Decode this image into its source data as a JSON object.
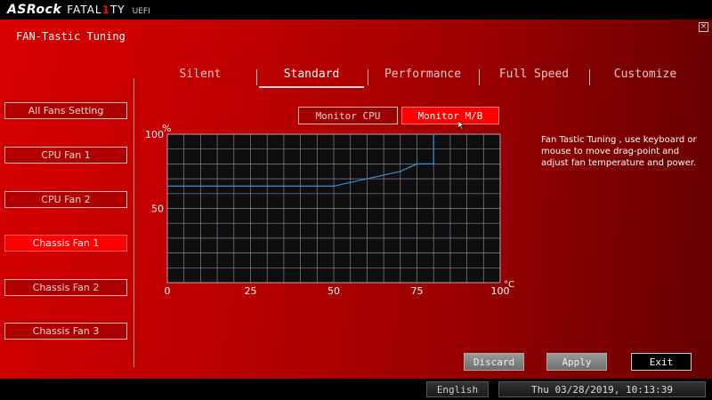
{
  "header": {
    "brand": "ASRock",
    "product_pre": "FATAL",
    "product_one": "1",
    "product_post": "TY",
    "edition": "UEFI",
    "close_glyph": "×"
  },
  "page_title": "FAN-Tastic Tuning",
  "sidebar": {
    "items": [
      {
        "label": "All Fans Setting",
        "active": false
      },
      {
        "label": "CPU Fan 1",
        "active": false
      },
      {
        "label": "CPU Fan 2",
        "active": false
      },
      {
        "label": "Chassis Fan 1",
        "active": true
      },
      {
        "label": "Chassis Fan 2",
        "active": false
      },
      {
        "label": "Chassis Fan 3",
        "active": false
      }
    ]
  },
  "tabs": [
    {
      "label": "Silent",
      "active": false
    },
    {
      "label": "Standard",
      "active": true
    },
    {
      "label": "Performance",
      "active": false
    },
    {
      "label": "Full Speed",
      "active": false
    },
    {
      "label": "Customize",
      "active": false
    }
  ],
  "monitor": {
    "cpu_label": "Monitor CPU",
    "mb_label": "Monitor M/B",
    "selected": "Monitor M/B"
  },
  "chart_data": {
    "type": "line",
    "y_unit": "%",
    "x_unit": "°C",
    "x_ticks": [
      "0",
      "25",
      "50",
      "75",
      "100"
    ],
    "y_ticks": [
      "50",
      "100"
    ],
    "xlim": [
      0,
      100
    ],
    "ylim": [
      0,
      100
    ],
    "grid": true,
    "series": [
      {
        "x": [
          0,
          50,
          60,
          70,
          75,
          80,
          80
        ],
        "y": [
          65,
          65,
          70,
          75,
          80,
          80,
          100
        ]
      }
    ],
    "colors": {
      "line": "#3a8fd8",
      "grid": "#b0a8b0",
      "plot_bg": "#0e0e10"
    }
  },
  "help_text": "Fan Tastic Tuning , use keyboard or mouse to move drag-point and adjust fan temperature and power.",
  "buttons": {
    "discard": "Discard",
    "apply": "Apply",
    "exit": "Exit"
  },
  "status": {
    "language": "English",
    "datetime": "Thu 03/28/2019, 10:13:39"
  }
}
